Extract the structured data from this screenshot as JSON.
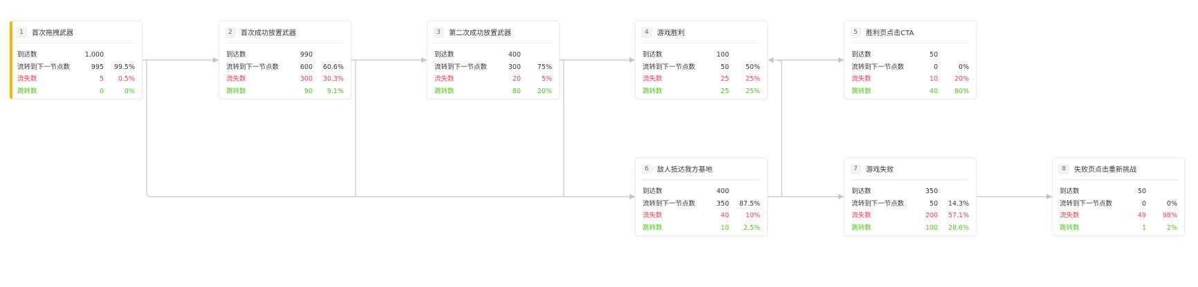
{
  "labels": {
    "arrive": "到达数",
    "flow_next": "流转到下一节点数",
    "lost": "流失数",
    "jump": "跳转数"
  },
  "colors": {
    "accent": "#f6b700",
    "lost": "#e8404f",
    "jump": "#52c41a",
    "edge": "#c4c4c4"
  },
  "nodes": [
    {
      "index": "1",
      "title": "首次拖拽武器",
      "arrive": "1,000",
      "flow": "995",
      "flow_pct": "99.5%",
      "lost": "5",
      "lost_pct": "0.5%",
      "jump": "0",
      "jump_pct": "0%",
      "selected": true
    },
    {
      "index": "2",
      "title": "首次成功放置武器",
      "arrive": "990",
      "flow": "600",
      "flow_pct": "60.6%",
      "lost": "300",
      "lost_pct": "30.3%",
      "jump": "90",
      "jump_pct": "9.1%"
    },
    {
      "index": "3",
      "title": "第二次成功放置武器",
      "arrive": "400",
      "flow": "300",
      "flow_pct": "75%",
      "lost": "20",
      "lost_pct": "5%",
      "jump": "80",
      "jump_pct": "20%"
    },
    {
      "index": "4",
      "title": "游戏胜利",
      "arrive": "100",
      "flow": "50",
      "flow_pct": "50%",
      "lost": "25",
      "lost_pct": "25%",
      "jump": "25",
      "jump_pct": "25%"
    },
    {
      "index": "5",
      "title": "胜利页点击CTA",
      "arrive": "50",
      "flow": "0",
      "flow_pct": "0%",
      "lost": "10",
      "lost_pct": "20%",
      "jump": "40",
      "jump_pct": "80%"
    },
    {
      "index": "6",
      "title": "敌人抵达我方基地",
      "arrive": "400",
      "flow": "350",
      "flow_pct": "87.5%",
      "lost": "40",
      "lost_pct": "10%",
      "jump": "10",
      "jump_pct": "2.5%"
    },
    {
      "index": "7",
      "title": "游戏失败",
      "arrive": "350",
      "flow": "50",
      "flow_pct": "14.3%",
      "lost": "200",
      "lost_pct": "57.1%",
      "jump": "100",
      "jump_pct": "28.6%"
    },
    {
      "index": "8",
      "title": "失败页点击重新挑战",
      "arrive": "50",
      "flow": "0",
      "flow_pct": "0%",
      "lost": "49",
      "lost_pct": "98%",
      "jump": "1",
      "jump_pct": "2%"
    }
  ]
}
